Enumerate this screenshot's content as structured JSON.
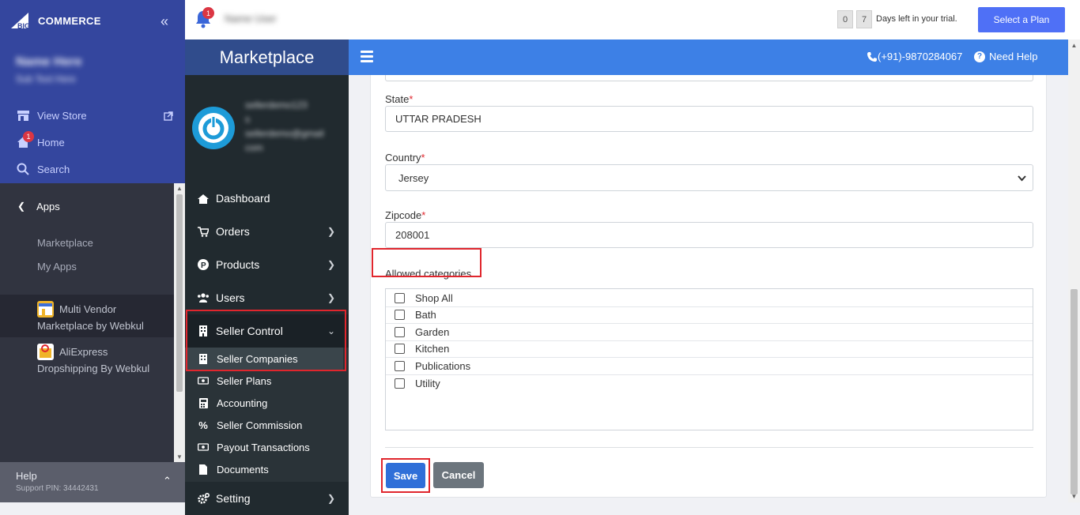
{
  "bc_sidebar": {
    "logo_text": "COMMERCE",
    "logo_big": "BIG",
    "store_name": "Name Here",
    "store_sub": "Sub Text Here",
    "nav": [
      {
        "label": "View Store",
        "icon": "store-icon"
      },
      {
        "label": "Home",
        "icon": "home-icon",
        "badge": "1"
      },
      {
        "label": "Search",
        "icon": "search-icon"
      }
    ],
    "apps_label": "Apps",
    "sub_items": [
      "Marketplace",
      "My Apps"
    ],
    "apps": [
      {
        "line1": "Multi Vendor",
        "line2": "Marketplace by Webkul"
      },
      {
        "line1": "AliExpress",
        "line2": "Dropshipping By Webkul"
      }
    ],
    "help_title": "Help",
    "help_pin": "Support PIN: 34442431"
  },
  "topbar": {
    "notif_count": "1",
    "user_name": "Name User",
    "trial_digits": [
      "0",
      "7"
    ],
    "trial_text": "Days left in your trial.",
    "plan_button": "Select a Plan"
  },
  "marketplace": {
    "brand": "Marketplace",
    "user_line1": "sellerdemo123",
    "user_line2": "s",
    "user_line3": "sellerdemo@gmail",
    "user_line4": "com",
    "menu": [
      {
        "label": "Dashboard"
      },
      {
        "label": "Orders"
      },
      {
        "label": "Products"
      },
      {
        "label": "Users"
      },
      {
        "label": "Seller Control"
      }
    ],
    "submenu": [
      {
        "label": "Seller Companies"
      },
      {
        "label": "Seller Plans"
      },
      {
        "label": "Accounting"
      },
      {
        "label": "Seller Commission"
      },
      {
        "label": "Payout Transactions"
      },
      {
        "label": "Documents"
      }
    ],
    "setting_label": "Setting"
  },
  "header": {
    "phone": "(+91)-9870284067",
    "help": "Need Help"
  },
  "form": {
    "state_label": "State",
    "state_value": "UTTAR PRADESH",
    "country_label": "Country",
    "country_value": "Jersey",
    "zip_label": "Zipcode",
    "zip_value": "208001",
    "categories_label": "Allowed categories",
    "categories": [
      "Shop All",
      "Bath",
      "Garden",
      "Kitchen",
      "Publications",
      "Utility"
    ],
    "save": "Save",
    "cancel": "Cancel"
  },
  "colors": {
    "bc_blue": "#34469e",
    "bc_dark": "#313440",
    "mp_dark": "#212a2f",
    "header_blue": "#3d80e6",
    "accent_red": "#e0262d"
  }
}
